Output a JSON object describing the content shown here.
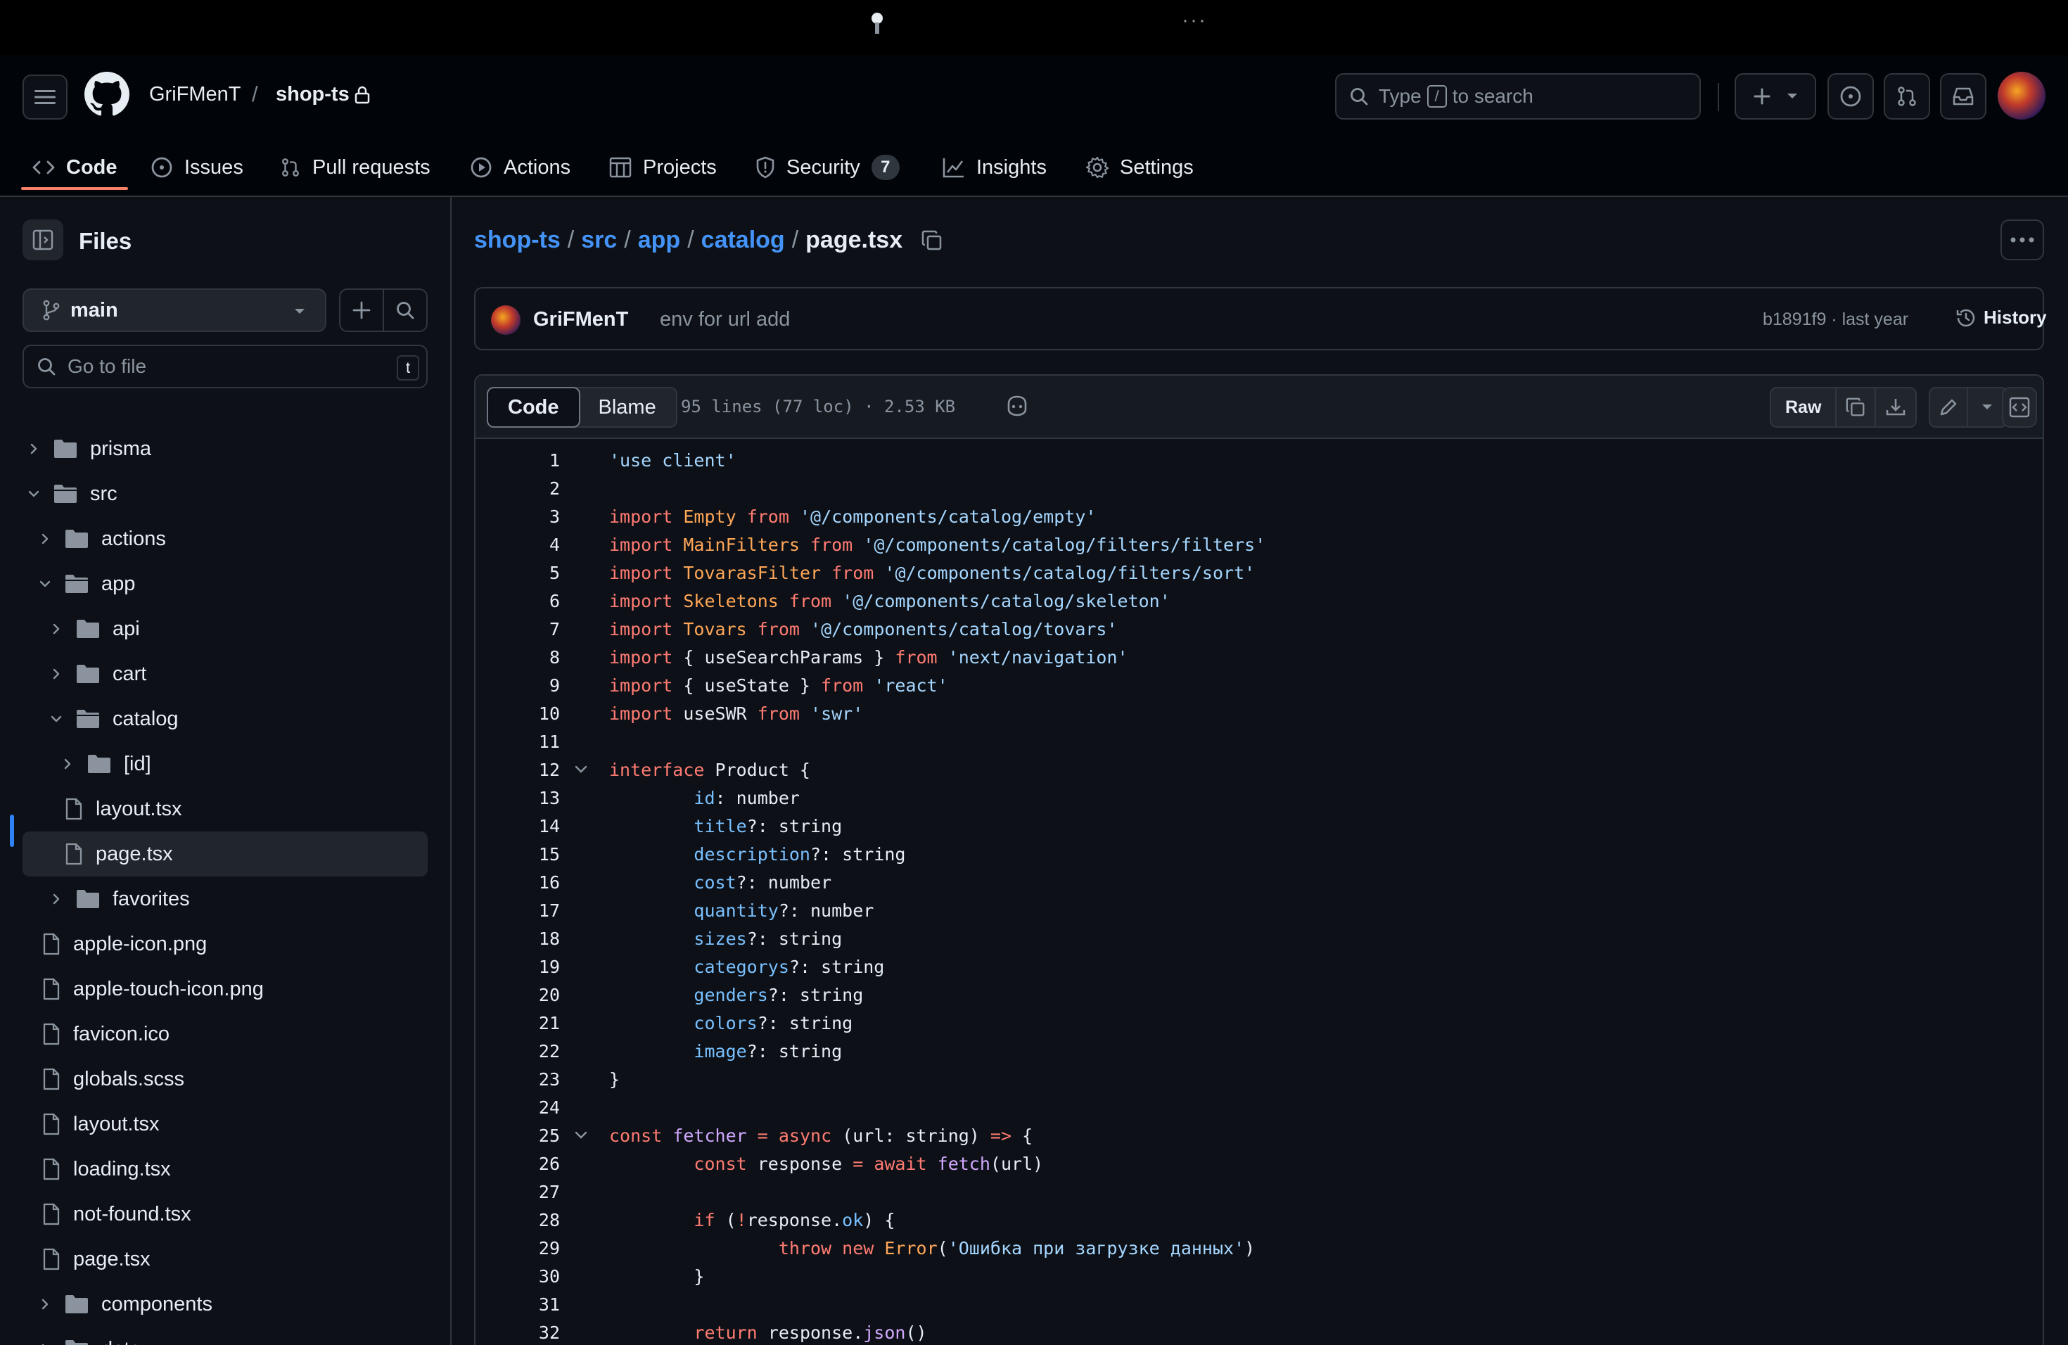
{
  "header": {
    "owner": "GriFMenT",
    "separator": "/",
    "repo": "shop-ts",
    "search_type": "Type",
    "search_key": "/",
    "search_rest": "to search"
  },
  "tabs": [
    {
      "label": "Code"
    },
    {
      "label": "Issues"
    },
    {
      "label": "Pull requests"
    },
    {
      "label": "Actions"
    },
    {
      "label": "Projects"
    },
    {
      "label": "Security",
      "count": "7"
    },
    {
      "label": "Insights"
    },
    {
      "label": "Settings"
    }
  ],
  "sidebar": {
    "title": "Files",
    "branch": "main",
    "goto_placeholder": "Go to file",
    "goto_key": "t",
    "tree": [
      {
        "name": "prisma",
        "type": "folder",
        "open": false
      },
      {
        "name": "src",
        "type": "folder",
        "open": true
      },
      {
        "name": "actions",
        "type": "folder",
        "open": false
      },
      {
        "name": "app",
        "type": "folder",
        "open": true
      },
      {
        "name": "api",
        "type": "folder",
        "open": false
      },
      {
        "name": "cart",
        "type": "folder",
        "open": false
      },
      {
        "name": "catalog",
        "type": "folder",
        "open": true
      },
      {
        "name": "[id]",
        "type": "folder",
        "open": false
      },
      {
        "name": "layout.tsx",
        "type": "file"
      },
      {
        "name": "page.tsx",
        "type": "file",
        "selected": true
      },
      {
        "name": "favorites",
        "type": "folder",
        "open": false
      },
      {
        "name": "apple-icon.png",
        "type": "file"
      },
      {
        "name": "apple-touch-icon.png",
        "type": "file"
      },
      {
        "name": "favicon.ico",
        "type": "file"
      },
      {
        "name": "globals.scss",
        "type": "file"
      },
      {
        "name": "layout.tsx",
        "type": "file"
      },
      {
        "name": "loading.tsx",
        "type": "file"
      },
      {
        "name": "not-found.tsx",
        "type": "file"
      },
      {
        "name": "page.tsx",
        "type": "file"
      },
      {
        "name": "components",
        "type": "folder",
        "open": false
      },
      {
        "name": "data",
        "type": "folder",
        "open": false
      }
    ]
  },
  "breadcrumb": {
    "parts": [
      "shop-ts",
      "src",
      "app",
      "catalog"
    ],
    "separator": "/",
    "current": "page.tsx"
  },
  "commit": {
    "author": "GriFMenT",
    "message": "env for url add",
    "meta": "b1891f9 · last year",
    "history_label": "History"
  },
  "file": {
    "tab_code": "Code",
    "tab_blame": "Blame",
    "meta": "95 lines (77 loc) · 2.53 KB",
    "raw_label": "Raw"
  },
  "code_lines": [
    {
      "n": "1",
      "tokens": [
        [
          "s",
          "'use client'"
        ]
      ]
    },
    {
      "n": "2",
      "tokens": []
    },
    {
      "n": "3",
      "tokens": [
        [
          "k",
          "import"
        ],
        [
          "",
          " "
        ],
        [
          "n",
          "Empty"
        ],
        [
          "",
          " "
        ],
        [
          "k",
          "from"
        ],
        [
          "",
          " "
        ],
        [
          "s",
          "'@/components/catalog/empty'"
        ]
      ]
    },
    {
      "n": "4",
      "tokens": [
        [
          "k",
          "import"
        ],
        [
          "",
          " "
        ],
        [
          "n",
          "MainFilters"
        ],
        [
          "",
          " "
        ],
        [
          "k",
          "from"
        ],
        [
          "",
          " "
        ],
        [
          "s",
          "'@/components/catalog/filters/filters'"
        ]
      ]
    },
    {
      "n": "5",
      "tokens": [
        [
          "k",
          "import"
        ],
        [
          "",
          " "
        ],
        [
          "n",
          "TovarasFilter"
        ],
        [
          "",
          " "
        ],
        [
          "k",
          "from"
        ],
        [
          "",
          " "
        ],
        [
          "s",
          "'@/components/catalog/filters/sort'"
        ]
      ]
    },
    {
      "n": "6",
      "tokens": [
        [
          "k",
          "import"
        ],
        [
          "",
          " "
        ],
        [
          "n",
          "Skeletons"
        ],
        [
          "",
          " "
        ],
        [
          "k",
          "from"
        ],
        [
          "",
          " "
        ],
        [
          "s",
          "'@/components/catalog/skeleton'"
        ]
      ]
    },
    {
      "n": "7",
      "tokens": [
        [
          "k",
          "import"
        ],
        [
          "",
          " "
        ],
        [
          "n",
          "Tovars"
        ],
        [
          "",
          " "
        ],
        [
          "k",
          "from"
        ],
        [
          "",
          " "
        ],
        [
          "s",
          "'@/components/catalog/tovars'"
        ]
      ]
    },
    {
      "n": "8",
      "tokens": [
        [
          "k",
          "import"
        ],
        [
          "",
          " { useSearchParams } "
        ],
        [
          "k",
          "from"
        ],
        [
          "",
          " "
        ],
        [
          "s",
          "'next/navigation'"
        ]
      ]
    },
    {
      "n": "9",
      "tokens": [
        [
          "k",
          "import"
        ],
        [
          "",
          " { useState } "
        ],
        [
          "k",
          "from"
        ],
        [
          "",
          " "
        ],
        [
          "s",
          "'react'"
        ]
      ]
    },
    {
      "n": "10",
      "tokens": [
        [
          "k",
          "import"
        ],
        [
          "",
          " useSWR "
        ],
        [
          "k",
          "from"
        ],
        [
          "",
          " "
        ],
        [
          "s",
          "'swr'"
        ]
      ]
    },
    {
      "n": "11",
      "tokens": []
    },
    {
      "n": "12",
      "fold": true,
      "tokens": [
        [
          "k",
          "interface"
        ],
        [
          "",
          " Product {"
        ]
      ]
    },
    {
      "n": "13",
      "tokens": [
        [
          "",
          "        "
        ],
        [
          "c",
          "id"
        ],
        [
          "",
          ": number"
        ]
      ]
    },
    {
      "n": "14",
      "tokens": [
        [
          "",
          "        "
        ],
        [
          "c",
          "title"
        ],
        [
          "",
          "?: string"
        ]
      ]
    },
    {
      "n": "15",
      "tokens": [
        [
          "",
          "        "
        ],
        [
          "c",
          "description"
        ],
        [
          "",
          "?: string"
        ]
      ]
    },
    {
      "n": "16",
      "tokens": [
        [
          "",
          "        "
        ],
        [
          "c",
          "cost"
        ],
        [
          "",
          "?: number"
        ]
      ]
    },
    {
      "n": "17",
      "tokens": [
        [
          "",
          "        "
        ],
        [
          "c",
          "quantity"
        ],
        [
          "",
          "?: number"
        ]
      ]
    },
    {
      "n": "18",
      "tokens": [
        [
          "",
          "        "
        ],
        [
          "c",
          "sizes"
        ],
        [
          "",
          "?: string"
        ]
      ]
    },
    {
      "n": "19",
      "tokens": [
        [
          "",
          "        "
        ],
        [
          "c",
          "categorys"
        ],
        [
          "",
          "?: string"
        ]
      ]
    },
    {
      "n": "20",
      "tokens": [
        [
          "",
          "        "
        ],
        [
          "c",
          "genders"
        ],
        [
          "",
          "?: string"
        ]
      ]
    },
    {
      "n": "21",
      "tokens": [
        [
          "",
          "        "
        ],
        [
          "c",
          "colors"
        ],
        [
          "",
          "?: string"
        ]
      ]
    },
    {
      "n": "22",
      "tokens": [
        [
          "",
          "        "
        ],
        [
          "c",
          "image"
        ],
        [
          "",
          "?: string"
        ]
      ]
    },
    {
      "n": "23",
      "tokens": [
        [
          "",
          "}"
        ]
      ]
    },
    {
      "n": "24",
      "tokens": []
    },
    {
      "n": "25",
      "fold": true,
      "tokens": [
        [
          "k",
          "const"
        ],
        [
          "",
          " "
        ],
        [
          "e",
          "fetcher"
        ],
        [
          "",
          " "
        ],
        [
          "k",
          "="
        ],
        [
          "",
          " "
        ],
        [
          "k",
          "async"
        ],
        [
          "",
          " (url: string) "
        ],
        [
          "k",
          "=>"
        ],
        [
          "",
          " {"
        ]
      ]
    },
    {
      "n": "26",
      "tokens": [
        [
          "",
          "        "
        ],
        [
          "k",
          "const"
        ],
        [
          "",
          " response "
        ],
        [
          "k",
          "="
        ],
        [
          "",
          " "
        ],
        [
          "k",
          "await"
        ],
        [
          "",
          " "
        ],
        [
          "e",
          "fetch"
        ],
        [
          "",
          "(url)"
        ]
      ]
    },
    {
      "n": "27",
      "tokens": []
    },
    {
      "n": "28",
      "tokens": [
        [
          "",
          "        "
        ],
        [
          "k",
          "if"
        ],
        [
          "",
          " ("
        ],
        [
          "k",
          "!"
        ],
        [
          "",
          "response."
        ],
        [
          "c",
          "ok"
        ],
        [
          "",
          ") {"
        ]
      ]
    },
    {
      "n": "29",
      "tokens": [
        [
          "",
          "                "
        ],
        [
          "k",
          "throw"
        ],
        [
          "",
          " "
        ],
        [
          "k",
          "new"
        ],
        [
          "",
          " "
        ],
        [
          "n",
          "Error"
        ],
        [
          "",
          "("
        ],
        [
          "s",
          "'Ошибка при загрузке данных'"
        ],
        [
          "",
          ")"
        ]
      ]
    },
    {
      "n": "30",
      "tokens": [
        [
          "",
          "        }"
        ]
      ]
    },
    {
      "n": "31",
      "tokens": []
    },
    {
      "n": "32",
      "tokens": [
        [
          "",
          "        "
        ],
        [
          "k",
          "return"
        ],
        [
          "",
          " response."
        ],
        [
          "e",
          "json"
        ],
        [
          "",
          "()"
        ]
      ]
    }
  ]
}
